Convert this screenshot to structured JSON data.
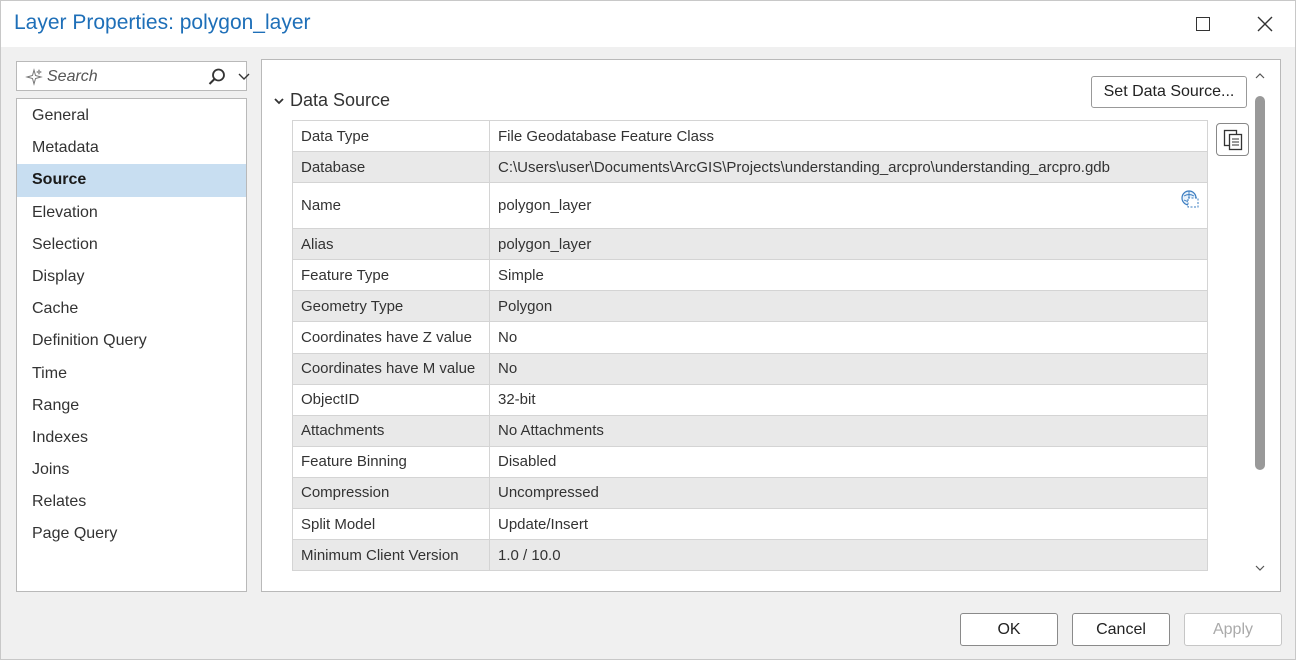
{
  "window": {
    "title": "Layer Properties: polygon_layer"
  },
  "search": {
    "placeholder": "Search"
  },
  "nav": {
    "active": "Source",
    "items": [
      {
        "label": "General"
      },
      {
        "label": "Metadata"
      },
      {
        "label": "Source"
      },
      {
        "label": "Elevation"
      },
      {
        "label": "Selection"
      },
      {
        "label": "Display"
      },
      {
        "label": "Cache"
      },
      {
        "label": "Definition Query"
      },
      {
        "label": "Time"
      },
      {
        "label": "Range"
      },
      {
        "label": "Indexes"
      },
      {
        "label": "Joins"
      },
      {
        "label": "Relates"
      },
      {
        "label": "Page Query"
      }
    ]
  },
  "main": {
    "section_title": "Data Source",
    "set_data_source_label": "Set Data Source...",
    "rows": [
      {
        "key": "Data Type",
        "value": "File Geodatabase Feature Class"
      },
      {
        "key": "Database",
        "value": "C:\\Users\\user\\Documents\\ArcGIS\\Projects\\understanding_arcpro\\understanding_arcpro.gdb"
      },
      {
        "key": "Name",
        "value": "polygon_layer"
      },
      {
        "key": "Alias",
        "value": "polygon_layer"
      },
      {
        "key": "Feature Type",
        "value": "Simple"
      },
      {
        "key": "Geometry Type",
        "value": "Polygon"
      },
      {
        "key": "Coordinates have Z value",
        "value": "No"
      },
      {
        "key": "Coordinates have M value",
        "value": "No"
      },
      {
        "key": "ObjectID",
        "value": "32-bit"
      },
      {
        "key": "Attachments",
        "value": "No Attachments"
      },
      {
        "key": "Feature Binning",
        "value": "Disabled"
      },
      {
        "key": "Compression",
        "value": "Uncompressed"
      },
      {
        "key": "Split Model",
        "value": "Update/Insert"
      },
      {
        "key": "Minimum Client Version",
        "value": "1.0 / 10.0"
      }
    ]
  },
  "footer": {
    "ok_label": "OK",
    "cancel_label": "Cancel",
    "apply_label": "Apply"
  },
  "colors": {
    "title": "#1e6fb8",
    "nav_active_bg": "#c8def1",
    "row_alt_bg": "#e9e9e9"
  }
}
